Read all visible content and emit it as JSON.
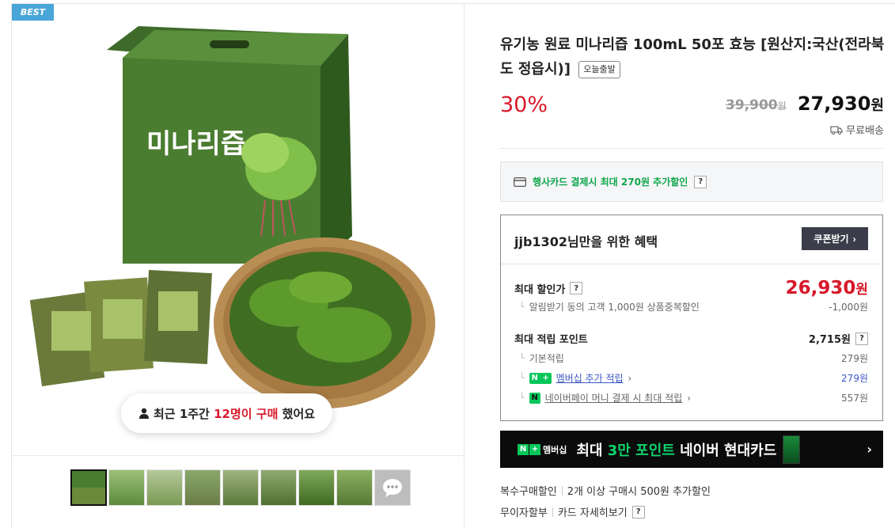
{
  "left": {
    "badge": "BEST",
    "recent": {
      "icon": "person-icon",
      "prefix": "최근 1주간",
      "highlight": "12명이 구매",
      "suffix": "했어요"
    },
    "product_box_text": "미나리즙",
    "thumbnails": [
      "thumb-1",
      "thumb-2",
      "thumb-3",
      "thumb-4",
      "thumb-5",
      "thumb-6",
      "thumb-7",
      "thumb-8"
    ],
    "more_icon": "chat-more-icon"
  },
  "product": {
    "title": "유기농 원료 미나리즙 100mL 50포 효능 [원산지:국산(전라북도 정읍시)]",
    "ship_badge": "오늘출발",
    "discount": "30%",
    "original_price": "39,900",
    "original_unit": "원",
    "final_price": "27,930",
    "final_unit": "원",
    "shipping": "무료배송"
  },
  "card_promo": {
    "text": "행사카드 결제시 최대 270원 추가할인",
    "help": "?"
  },
  "benefit": {
    "title": "jjb1302님만을 위한 혜택",
    "coupon_button": "쿠폰받기",
    "max_price_label": "최대 할인가",
    "max_price": "26,930",
    "max_price_unit": "원",
    "alarm_label": "알림받기 동의 고객 1,000원 상품중복할인",
    "alarm_value": "-1,000원",
    "points_label": "최대 적립 포인트",
    "points_value": "2,715원",
    "basic_label": "기본적립",
    "basic_value": "279원",
    "membership_label": "멤버십 추가 적립",
    "membership_value": "279원",
    "npay_label": "네이버페이 머니 결제 시 최대 적립",
    "npay_value": "557원",
    "help": "?"
  },
  "banner": {
    "member": "멤버십",
    "pre": "최대 ",
    "hi": "3만 포인트",
    "post": " 네이버 현대카드"
  },
  "footer": {
    "multi_label": "복수구매할인",
    "multi_value": "2개 이상 구매시 500원 추가할인",
    "install_label": "무이자할부",
    "install_value": "카드 자세히보기",
    "help": "?"
  },
  "colors": {
    "accent_red": "#d7192a",
    "naver_green": "#08c75a",
    "best_blue": "#4aa6d8"
  }
}
